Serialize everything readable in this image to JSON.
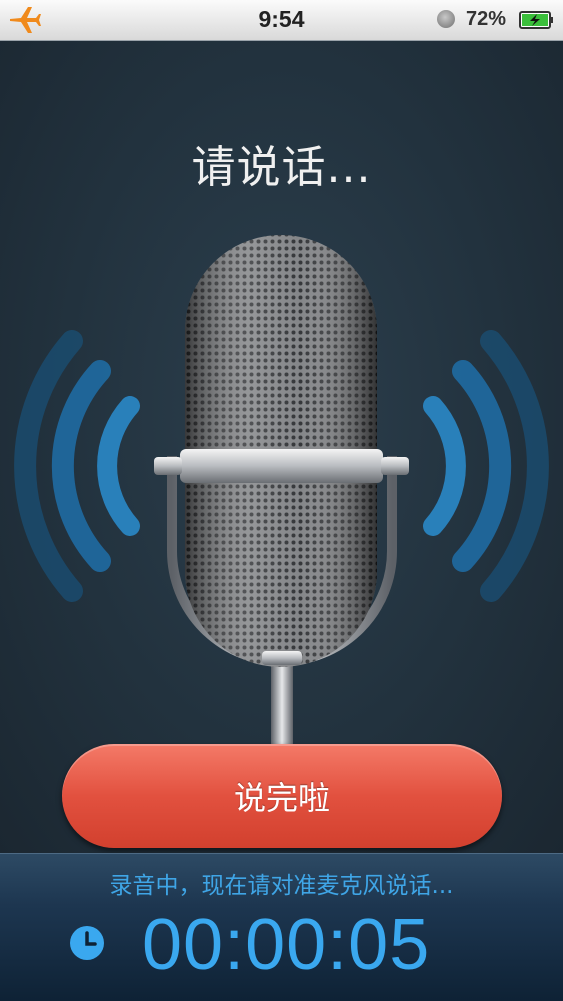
{
  "status_bar": {
    "time": "9:54",
    "battery_percent": "72",
    "battery_suffix": "%",
    "icons": [
      "airplane-icon",
      "alarm-icon",
      "battery-charging-icon"
    ]
  },
  "recorder": {
    "title": "请说话...",
    "done_button_label": "说完啦",
    "status_text": "录音中，现在请对准麦克风说话...",
    "elapsed": "00:00:05"
  },
  "colors": {
    "background": "#22323e",
    "accent_blue": "#3aa8ef",
    "button_red": "#e2513f"
  }
}
